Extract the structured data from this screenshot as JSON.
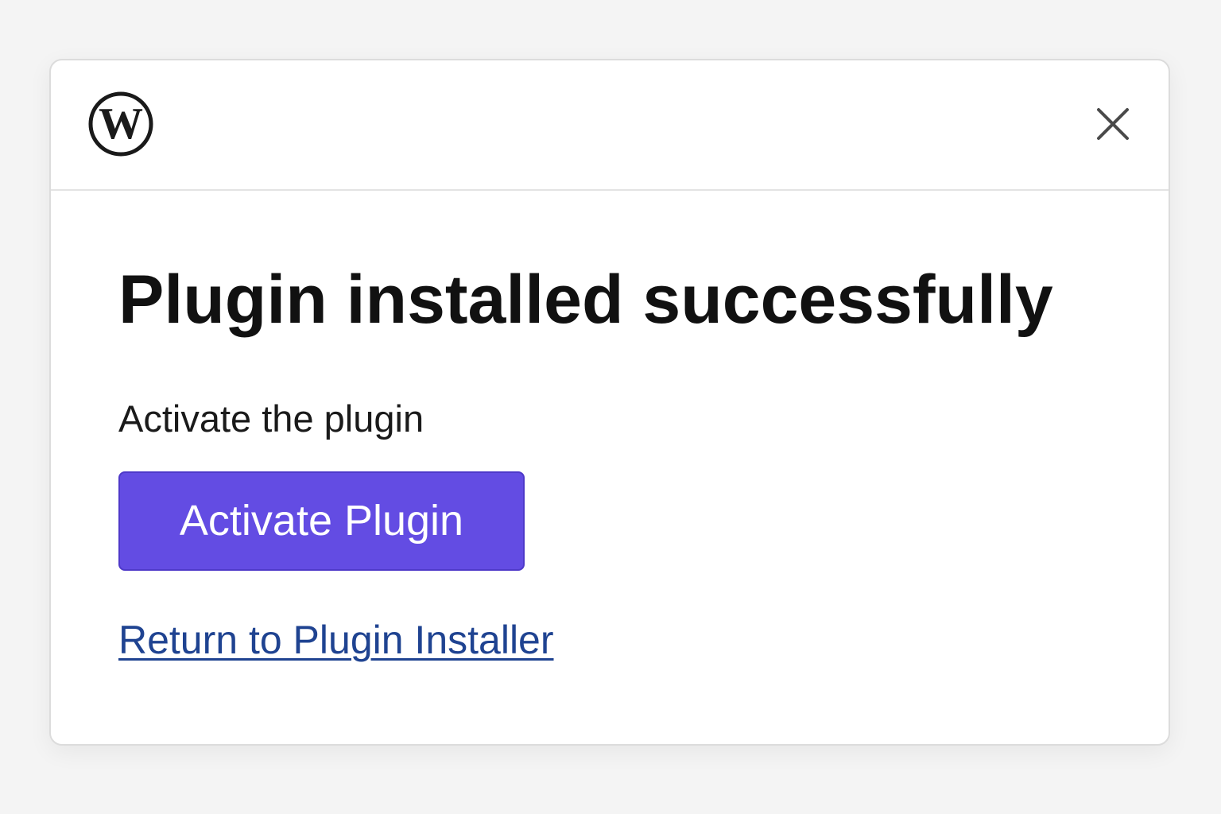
{
  "header": {
    "logo_icon": "wordpress-logo-icon",
    "close_icon": "close-icon"
  },
  "main": {
    "title": "Plugin installed successfully",
    "subtitle": "Activate the plugin",
    "activate_button_label": "Activate Plugin",
    "return_link_label": "Return to Plugin Installer"
  },
  "colors": {
    "accent": "#634ce3",
    "link": "#1f4391",
    "text": "#111111"
  }
}
